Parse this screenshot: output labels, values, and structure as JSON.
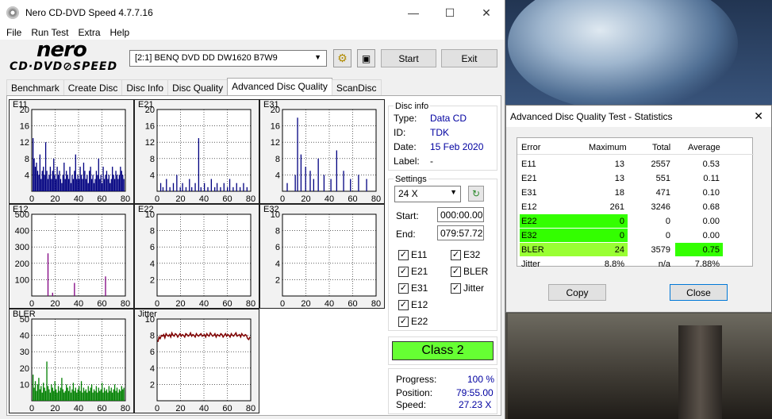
{
  "main_window": {
    "title": "Nero CD-DVD Speed 4.7.7.16",
    "minimize": "—",
    "maximize": "☐",
    "close": "✕"
  },
  "menu": [
    "File",
    "Run Test",
    "Extra",
    "Help"
  ],
  "logo": {
    "top": "nero",
    "bottom": "CD·DVD⊘SPEED"
  },
  "toolbar": {
    "drive": "[2:1]   BENQ DVD DD DW1620 B7W9",
    "start_label": "Start",
    "exit_label": "Exit"
  },
  "tabs": [
    "Benchmark",
    "Create Disc",
    "Disc Info",
    "Disc Quality",
    "Advanced Disc Quality",
    "ScanDisc"
  ],
  "active_tab": 4,
  "disc_info": {
    "title": "Disc info",
    "type_label": "Type:",
    "type": "Data CD",
    "id_label": "ID:",
    "id": "TDK",
    "date_label": "Date:",
    "date": "15 Feb 2020",
    "label_label": "Label:",
    "label": "-"
  },
  "settings": {
    "title": "Settings",
    "speed": "24 X",
    "start_label": "Start:",
    "start": "000:00.00",
    "end_label": "End:",
    "end": "079:57.72",
    "checks": {
      "E11": true,
      "E32": true,
      "E21": true,
      "BLER": true,
      "E31": true,
      "Jitter": true,
      "E12": true,
      "E22": true
    },
    "check_labels": {
      "e11": "E11",
      "e32": "E32",
      "e21": "E21",
      "bler": "BLER",
      "e31": "E31",
      "jitter": "Jitter",
      "e12": "E12",
      "e22": "E22"
    }
  },
  "class_label": "Class 2",
  "progress": {
    "progress_label": "Progress:",
    "progress": "100 %",
    "position_label": "Position:",
    "position": "79:55.00",
    "speed_label": "Speed:",
    "speed": "27.23 X"
  },
  "chart_data": [
    {
      "type": "bar",
      "title": "E11",
      "color": "#000080",
      "xlim": [
        0,
        80
      ],
      "ylim": [
        0,
        20
      ],
      "yticks": [
        "20",
        "16",
        "12",
        "8",
        "4"
      ],
      "xticks": [
        "0",
        "20",
        "40",
        "60",
        "80"
      ],
      "values": [
        13,
        8,
        6,
        7,
        5,
        4,
        9,
        3,
        5,
        6,
        4,
        12,
        5,
        3,
        4,
        6,
        3,
        5,
        8,
        4,
        3,
        6,
        4,
        5,
        3,
        2,
        4,
        7,
        3,
        5,
        4,
        3,
        6,
        2,
        4,
        3,
        5,
        9,
        3,
        4,
        3,
        6,
        4,
        3,
        7,
        5,
        3,
        4,
        2,
        5,
        6,
        3,
        4,
        2,
        3,
        5,
        4,
        8,
        3,
        4,
        2,
        6,
        3,
        4,
        5,
        3,
        4,
        2,
        3,
        6,
        4,
        3,
        5,
        4,
        3,
        4,
        6,
        5,
        4,
        3
      ]
    },
    {
      "type": "bar",
      "title": "E21",
      "color": "#000080",
      "xlim": [
        0,
        80
      ],
      "ylim": [
        0,
        20
      ],
      "yticks": [
        "20",
        "16",
        "12",
        "8",
        "4"
      ],
      "xticks": [
        "0",
        "20",
        "40",
        "60",
        "80"
      ],
      "values": [
        0,
        0,
        2,
        0,
        1,
        0,
        0,
        3,
        0,
        0,
        1,
        0,
        0,
        2,
        0,
        0,
        4,
        0,
        0,
        1,
        0,
        2,
        0,
        0,
        1,
        0,
        0,
        3,
        0,
        1,
        0,
        0,
        2,
        0,
        0,
        13,
        0,
        1,
        0,
        0,
        2,
        0,
        0,
        1,
        0,
        0,
        3,
        0,
        0,
        1,
        0,
        2,
        0,
        0,
        1,
        0,
        0,
        2,
        0,
        0,
        1,
        0,
        3,
        0,
        0,
        1,
        0,
        0,
        2,
        0,
        0,
        1,
        0,
        0,
        2,
        0,
        0,
        1,
        0,
        0
      ]
    },
    {
      "type": "bar",
      "title": "E31",
      "color": "#000080",
      "xlim": [
        0,
        80
      ],
      "ylim": [
        0,
        20
      ],
      "yticks": [
        "20",
        "16",
        "12",
        "8",
        "4"
      ],
      "xticks": [
        "0",
        "20",
        "40",
        "60",
        "80"
      ],
      "values": [
        0,
        0,
        0,
        2,
        0,
        0,
        0,
        0,
        0,
        0,
        4,
        0,
        18,
        0,
        0,
        9,
        0,
        0,
        0,
        6,
        0,
        0,
        0,
        5,
        0,
        0,
        3,
        0,
        0,
        0,
        8,
        0,
        0,
        0,
        0,
        4,
        0,
        0,
        0,
        0,
        0,
        3,
        0,
        0,
        0,
        0,
        10,
        0,
        0,
        0,
        0,
        0,
        5,
        0,
        0,
        0,
        0,
        0,
        3,
        0,
        0,
        0,
        0,
        0,
        0,
        4,
        0,
        0,
        0,
        0,
        0,
        0,
        3,
        0,
        0,
        0,
        0,
        0,
        0,
        0
      ]
    },
    {
      "type": "bar",
      "title": "E12",
      "color": "#800080",
      "xlim": [
        0,
        80
      ],
      "ylim": [
        0,
        500
      ],
      "yticks": [
        "500",
        "400",
        "300",
        "200",
        "100"
      ],
      "xticks": [
        "0",
        "20",
        "40",
        "60",
        "80"
      ],
      "values": [
        0,
        0,
        0,
        0,
        0,
        0,
        0,
        0,
        0,
        0,
        0,
        0,
        0,
        261,
        0,
        0,
        0,
        20,
        0,
        0,
        0,
        0,
        0,
        0,
        0,
        0,
        0,
        0,
        0,
        0,
        0,
        0,
        0,
        0,
        0,
        0,
        80,
        0,
        0,
        0,
        0,
        0,
        0,
        0,
        0,
        0,
        0,
        0,
        0,
        0,
        0,
        0,
        0,
        0,
        0,
        0,
        0,
        0,
        0,
        0,
        0,
        0,
        0,
        120,
        0,
        0,
        0,
        0,
        0,
        0,
        0,
        0,
        0,
        0,
        0,
        0,
        0,
        0,
        0,
        0
      ]
    },
    {
      "type": "bar",
      "title": "E22",
      "color": "#000080",
      "xlim": [
        0,
        80
      ],
      "ylim": [
        0,
        10
      ],
      "yticks": [
        "10",
        "8",
        "6",
        "4",
        "2"
      ],
      "xticks": [
        "0",
        "20",
        "40",
        "60",
        "80"
      ],
      "values": []
    },
    {
      "type": "bar",
      "title": "E32",
      "color": "#000080",
      "xlim": [
        0,
        80
      ],
      "ylim": [
        0,
        10
      ],
      "yticks": [
        "10",
        "8",
        "6",
        "4",
        "2"
      ],
      "xticks": [
        "0",
        "20",
        "40",
        "60",
        "80"
      ],
      "values": []
    },
    {
      "type": "bar",
      "title": "BLER",
      "color": "#008000",
      "xlim": [
        0,
        80
      ],
      "ylim": [
        0,
        50
      ],
      "yticks": [
        "50",
        "40",
        "30",
        "20",
        "10"
      ],
      "xticks": [
        "0",
        "20",
        "40",
        "60",
        "80"
      ],
      "values": [
        16,
        8,
        12,
        6,
        10,
        14,
        7,
        9,
        5,
        11,
        8,
        6,
        24,
        9,
        7,
        5,
        10,
        8,
        6,
        12,
        7,
        5,
        9,
        6,
        8,
        14,
        7,
        5,
        6,
        10,
        8,
        6,
        9,
        5,
        7,
        11,
        6,
        8,
        5,
        7,
        9,
        6,
        12,
        5,
        8,
        6,
        7,
        5,
        9,
        6,
        8,
        10,
        5,
        7,
        6,
        9,
        5,
        8,
        6,
        7,
        11,
        5,
        8,
        6,
        7,
        5,
        9,
        6,
        8,
        5,
        7,
        10,
        6,
        8,
        5,
        7,
        6,
        9,
        7,
        8
      ]
    },
    {
      "type": "line",
      "title": "Jitter",
      "color": "#800000",
      "xlim": [
        0,
        80
      ],
      "ylim": [
        0,
        10
      ],
      "yticks": [
        "10",
        "8",
        "6",
        "4",
        "2"
      ],
      "xticks": [
        "0",
        "20",
        "40",
        "60",
        "80"
      ],
      "values": [
        7.2,
        7.8,
        7.6,
        8.0,
        7.9,
        8.1,
        7.7,
        8.2,
        8.0,
        7.9,
        8.1,
        7.8,
        8.3,
        8.0,
        7.9,
        8.2,
        8.1,
        7.8,
        8.0,
        8.2,
        7.9,
        8.1,
        8.0,
        7.8,
        8.2,
        8.1,
        7.9,
        8.0,
        8.3,
        7.9,
        8.1,
        8.0,
        7.8,
        8.2,
        8.0,
        7.9,
        8.1,
        8.2,
        7.9,
        8.0,
        8.1,
        7.8,
        8.2,
        8.0,
        7.9,
        8.3,
        8.1,
        7.9,
        8.0,
        8.2,
        7.8,
        8.1,
        8.0,
        7.9,
        8.2,
        8.1,
        7.8,
        8.0,
        8.2,
        7.9,
        8.1,
        8.0,
        7.8,
        8.2,
        8.0,
        7.9,
        8.1,
        8.3,
        7.9,
        8.0,
        8.1,
        7.8,
        8.2,
        8.0,
        7.9,
        8.1,
        8.0,
        7.6,
        7.5,
        7.8
      ]
    }
  ],
  "stats_window": {
    "title": "Advanced Disc Quality Test - Statistics",
    "close_x": "✕",
    "headers": [
      "Error",
      "Maximum",
      "Total",
      "Average"
    ],
    "rows": [
      {
        "name": "E11",
        "max": "13",
        "total": "2557",
        "avg": "0.53"
      },
      {
        "name": "E21",
        "max": "13",
        "total": "551",
        "avg": "0.11"
      },
      {
        "name": "E31",
        "max": "18",
        "total": "471",
        "avg": "0.10"
      },
      {
        "name": "E12",
        "max": "261",
        "total": "3246",
        "avg": "0.68"
      },
      {
        "name": "E22",
        "max": "0",
        "total": "0",
        "avg": "0.00"
      },
      {
        "name": "E32",
        "max": "0",
        "total": "0",
        "avg": "0.00"
      },
      {
        "name": "BLER",
        "max": "24",
        "total": "3579",
        "avg": "0.75"
      },
      {
        "name": "Jitter",
        "max": "8.8%",
        "total": "n/a",
        "avg": "7.88%"
      }
    ],
    "highlight_color": "#33ff00",
    "bler_highlight_color": "#99ff33",
    "copy_label": "Copy",
    "close_label": "Close"
  }
}
